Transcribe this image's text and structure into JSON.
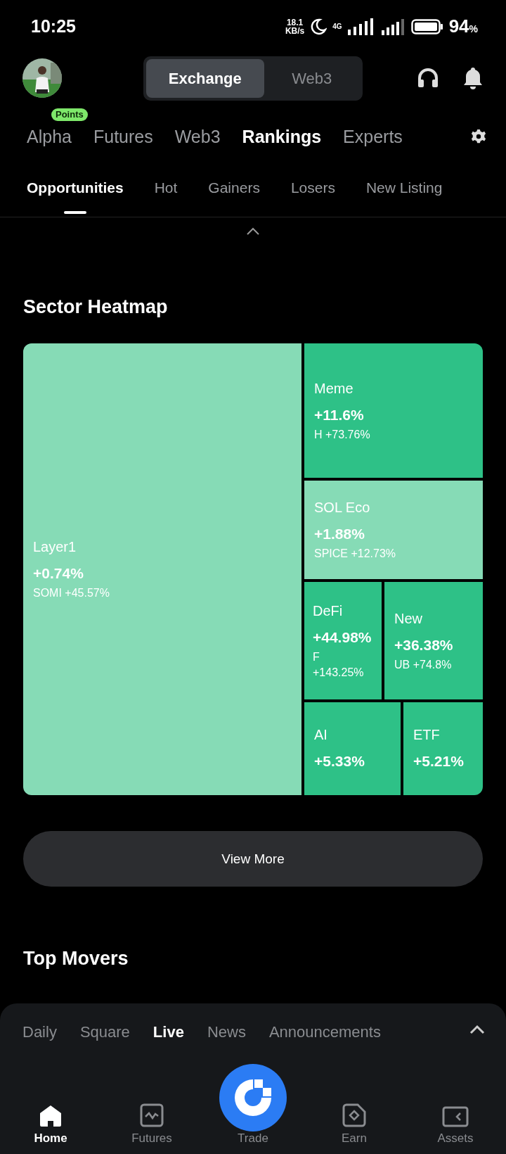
{
  "status_bar": {
    "time": "10:25",
    "speed": "18.1",
    "speed_unit": "KB/s",
    "network": "4G",
    "battery": "94",
    "battery_unit": "%"
  },
  "header": {
    "segments": [
      {
        "label": "Exchange",
        "selected": true
      },
      {
        "label": "Web3",
        "selected": false
      }
    ]
  },
  "main_tabs": [
    {
      "label": "Alpha",
      "selected": false,
      "badge": "Points"
    },
    {
      "label": "Futures",
      "selected": false
    },
    {
      "label": "Web3",
      "selected": false
    },
    {
      "label": "Rankings",
      "selected": true
    },
    {
      "label": "Experts",
      "selected": false
    }
  ],
  "sub_tabs": [
    {
      "label": "Opportunities",
      "selected": true
    },
    {
      "label": "Hot",
      "selected": false
    },
    {
      "label": "Gainers",
      "selected": false
    },
    {
      "label": "Losers",
      "selected": false
    },
    {
      "label": "New Listing",
      "selected": false
    }
  ],
  "heatmap": {
    "title": "Sector Heatmap",
    "button": "View More",
    "tiles": [
      {
        "name": "Layer1",
        "change": "+0.74%",
        "top_coin": "SOMI +45.57%",
        "color": "#86dbb6"
      },
      {
        "name": "Meme",
        "change": "+11.6%",
        "top_coin": "H +73.76%",
        "color": "#2ec187"
      },
      {
        "name": "SOL Eco",
        "change": "+1.88%",
        "top_coin": "SPICE +12.73%",
        "color": "#86dbb6"
      },
      {
        "name": "DeFi",
        "change": "+44.98%",
        "top_coin": "F +143.25%",
        "color": "#2ec187"
      },
      {
        "name": "New",
        "change": "+36.38%",
        "top_coin": "UB +74.8%",
        "color": "#2ec187"
      },
      {
        "name": "AI",
        "change": "+5.33%",
        "color": "#2ec187"
      },
      {
        "name": "ETF",
        "change": "+5.21%",
        "color": "#2ec187"
      }
    ]
  },
  "top_movers": {
    "title": "Top Movers"
  },
  "bottom_sheet": {
    "tabs": [
      {
        "label": "Daily",
        "selected": false
      },
      {
        "label": "Square",
        "selected": false
      },
      {
        "label": "Live",
        "selected": true
      },
      {
        "label": "News",
        "selected": false
      },
      {
        "label": "Announcements",
        "selected": false
      }
    ],
    "nav": [
      {
        "label": "Home",
        "kind": "home",
        "selected": true
      },
      {
        "label": "Futures",
        "kind": "futures",
        "selected": false
      },
      {
        "label": "Trade",
        "kind": "trade",
        "selected": false
      },
      {
        "label": "Earn",
        "kind": "earn",
        "selected": false
      },
      {
        "label": "Assets",
        "kind": "assets",
        "selected": false
      }
    ]
  }
}
